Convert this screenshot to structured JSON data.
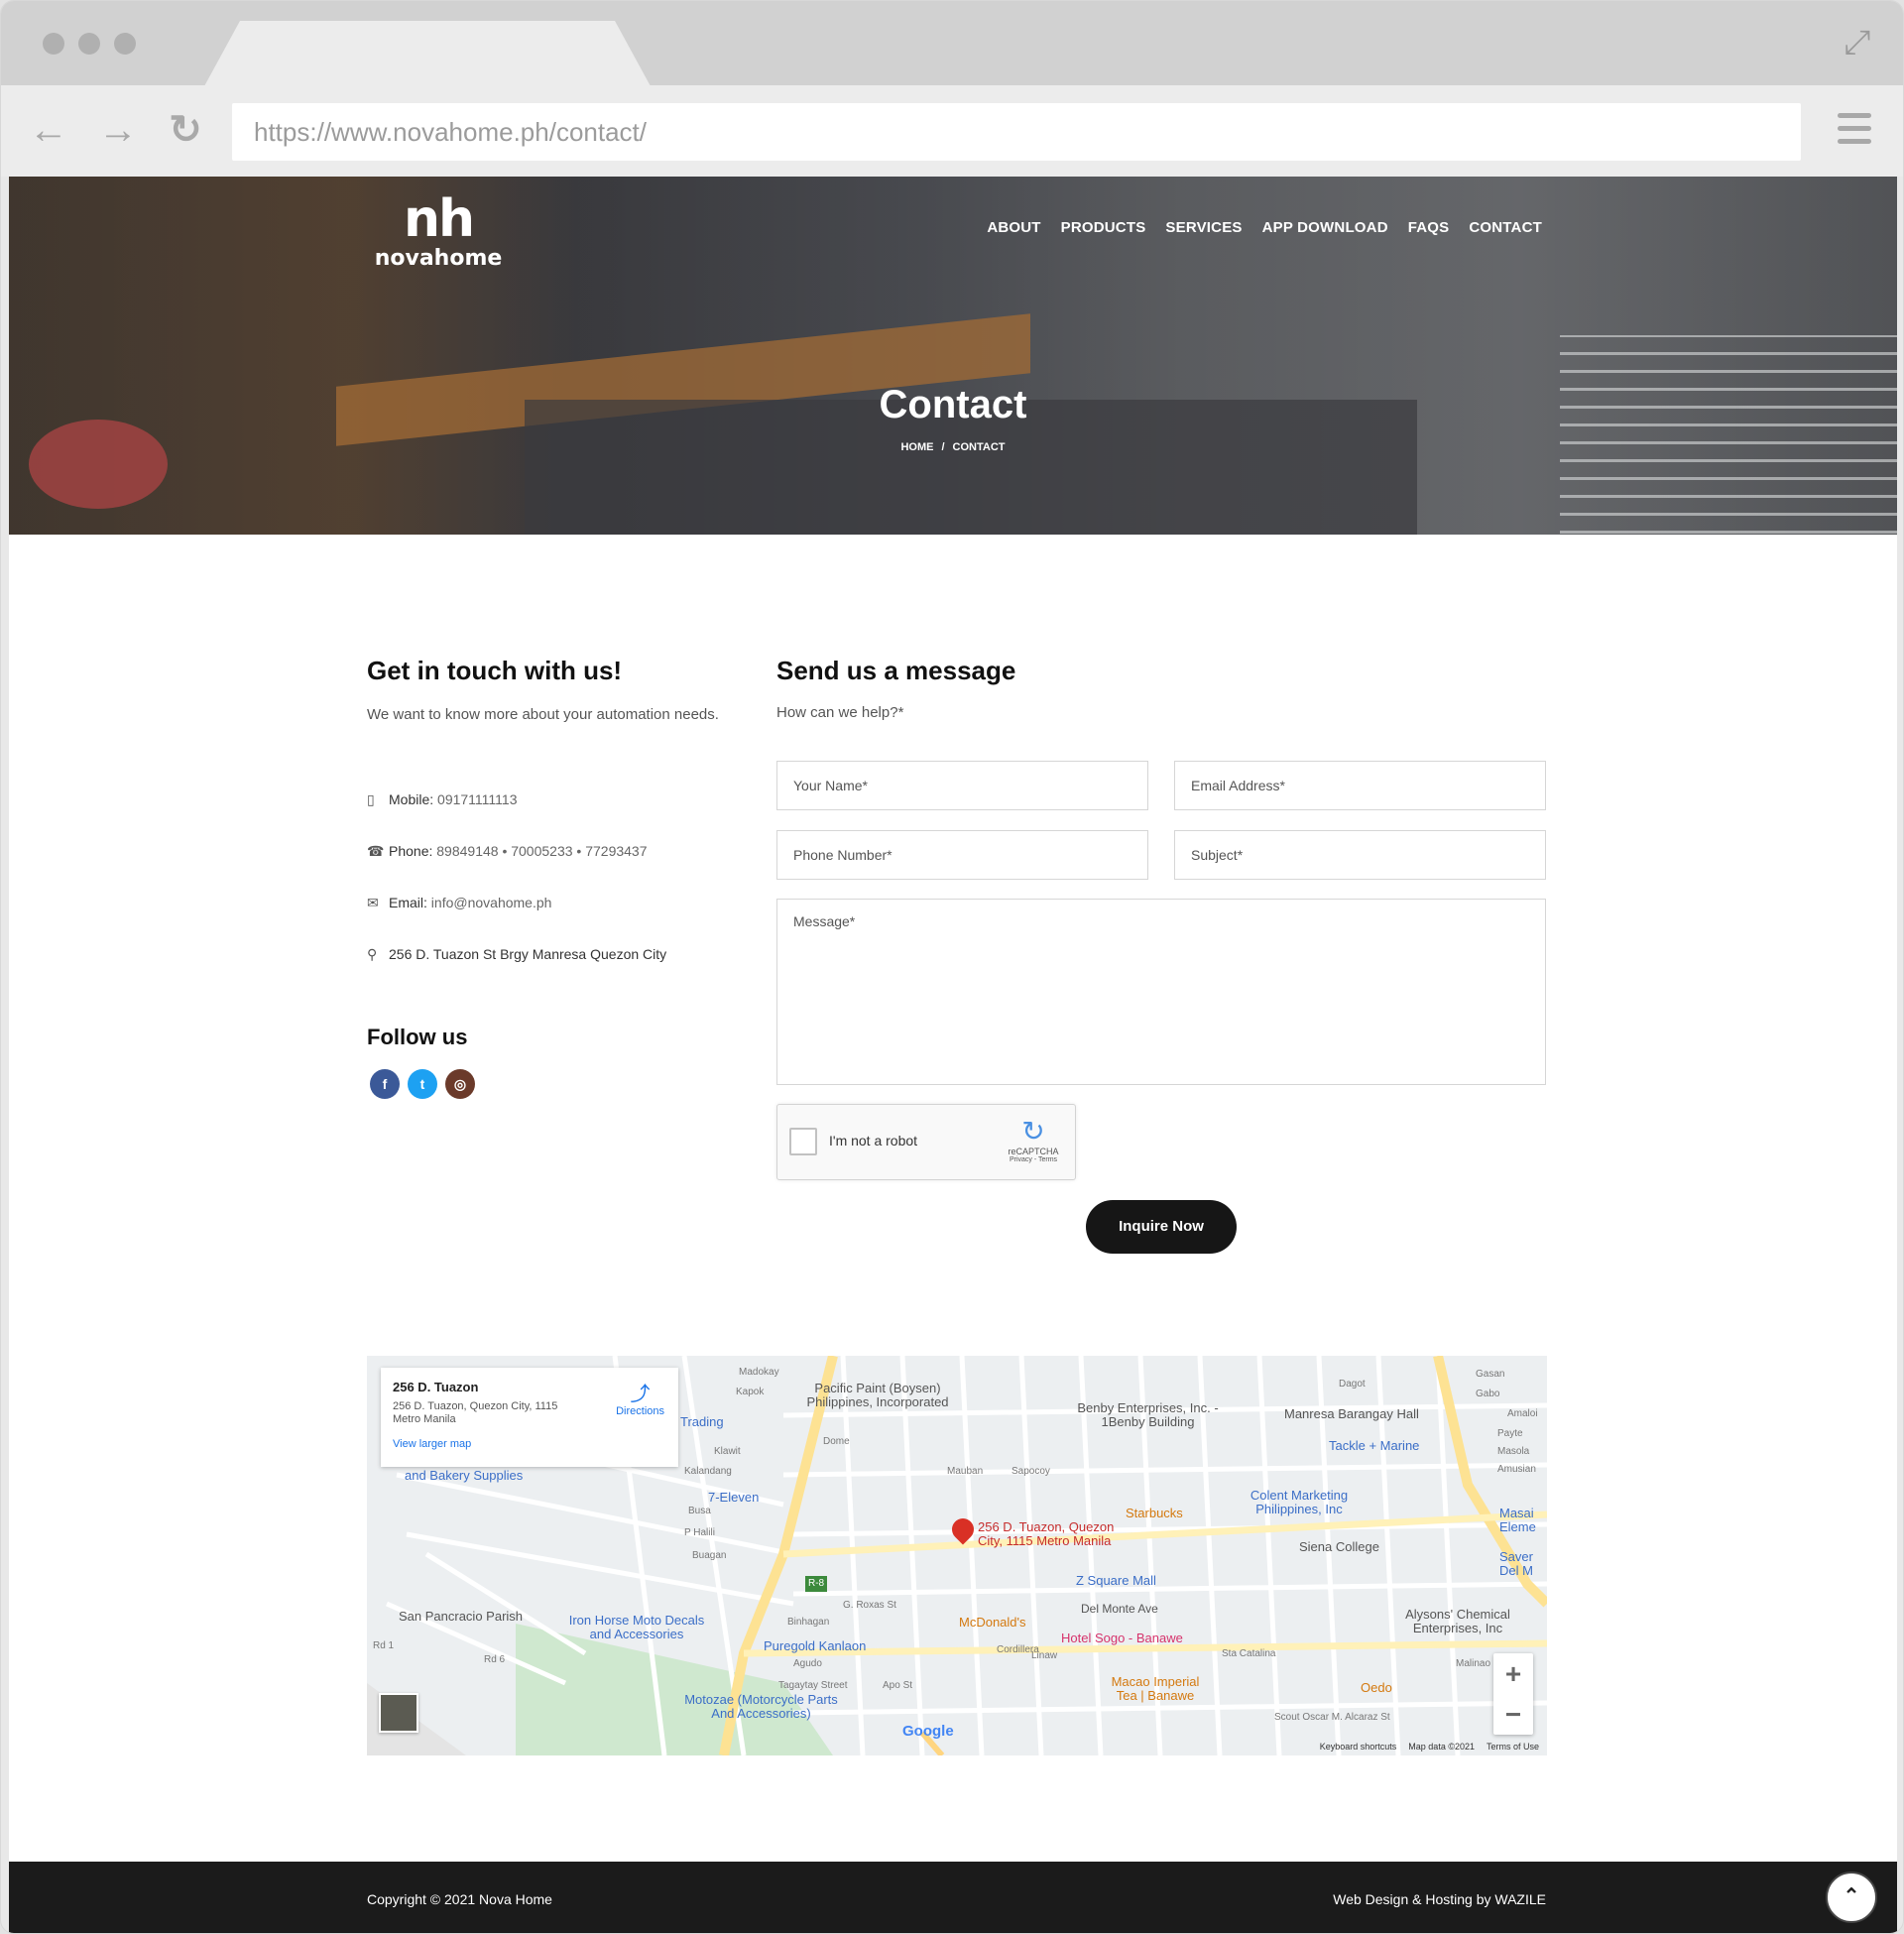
{
  "browser": {
    "url": "https://www.novahome.ph/contact/"
  },
  "site": {
    "logo_mark": "nh",
    "logo_word": "novahome",
    "nav": [
      "ABOUT",
      "PRODUCTS",
      "SERVICES",
      "APP DOWNLOAD",
      "FAQS",
      "CONTACT"
    ]
  },
  "hero": {
    "title": "Contact",
    "breadcrumb_home": "HOME",
    "breadcrumb_sep": "/",
    "breadcrumb_current": "CONTACT"
  },
  "contact": {
    "heading": "Get in touch with us!",
    "intro": "We want to know more about your automation needs.",
    "mobile_label": "Mobile:",
    "mobile": "09171111113",
    "phone_label": "Phone:",
    "phone": "89849148 • 70005233 • 77293437",
    "email_label": "Email:",
    "email": "info@novahome.ph",
    "address": "256 D. Tuazon St Brgy Manresa Quezon City",
    "follow_heading": "Follow us"
  },
  "form": {
    "heading": "Send us a message",
    "subheading": "How can we help?*",
    "name_placeholder": "Your Name*",
    "email_placeholder": "Email Address*",
    "phone_placeholder": "Phone Number*",
    "subject_placeholder": "Subject*",
    "message_placeholder": "Message*",
    "captcha_label": "I'm not a robot",
    "captcha_brand": "reCAPTCHA",
    "captcha_links": "Privacy - Terms",
    "submit_label": "Inquire Now"
  },
  "map": {
    "place_title": "256 D. Tuazon",
    "place_address": "256 D. Tuazon, Quezon City, 1115 Metro Manila",
    "directions_label": "Directions",
    "larger_map_label": "View larger map",
    "pin_label": "256 D. Tuazon, Quezon City, 1115 Metro Manila",
    "places": [
      "Pacific Paint (Boysen) Philippines, Incorporated",
      "Benby Enterprises, Inc. - 1Benby Building",
      "Manresa Barangay Hall",
      "Tackle + Marine",
      "Trading",
      "and Bakery Supplies",
      "7-Eleven",
      "Starbucks",
      "Colent Marketing Philippines, Inc",
      "Siena College",
      "Z Square Mall",
      "San Pancracio Parish",
      "Iron Horse Moto Decals and Accessories",
      "McDonald's",
      "Hotel Sogo - Banawe",
      "Alysons' Chemical Enterprises, Inc",
      "Puregold Kanlaon",
      "Macao Imperial Tea | Banawe",
      "Oedo",
      "Motozae (Motorcycle Parts And Accessories)",
      "Masai Eleme",
      "Saver Del M"
    ],
    "streets": [
      "Madokay",
      "Kapok",
      "Dome",
      "Klawit",
      "Kalandang",
      "Busa",
      "P Halili",
      "Buagan",
      "Mauban",
      "Sapocoy",
      "Del Monte Ave",
      "G. Roxas St",
      "Agudo",
      "Tagaytay Street",
      "Apo St",
      "Cordillera",
      "Linaw",
      "Sta Catalina",
      "Malinao",
      "Scout Oscar M. Alcaraz St",
      "Binhagan",
      "Dagot",
      "Gasan",
      "Gabo",
      "Amaloi",
      "Payte",
      "Masola",
      "Amusian",
      "Rd 6",
      "Rd 1",
      "R-8"
    ],
    "google_label": "Google",
    "footer_links": [
      "Keyboard shortcuts",
      "Map data ©2021",
      "Terms of Use"
    ]
  },
  "footer": {
    "copyright": "Copyright © 2021 Nova Home",
    "credit": "Web Design & Hosting by WAZILE"
  },
  "icons": {
    "back": "arrow-left-icon",
    "forward": "arrow-right-icon",
    "reload": "reload-icon",
    "menu": "hamburger-icon",
    "expand": "expand-icon"
  },
  "colors": {
    "accent_dark": "#161616",
    "facebook": "#3b5998",
    "twitter": "#1da1f2",
    "instagram": "#6b3a2a"
  }
}
